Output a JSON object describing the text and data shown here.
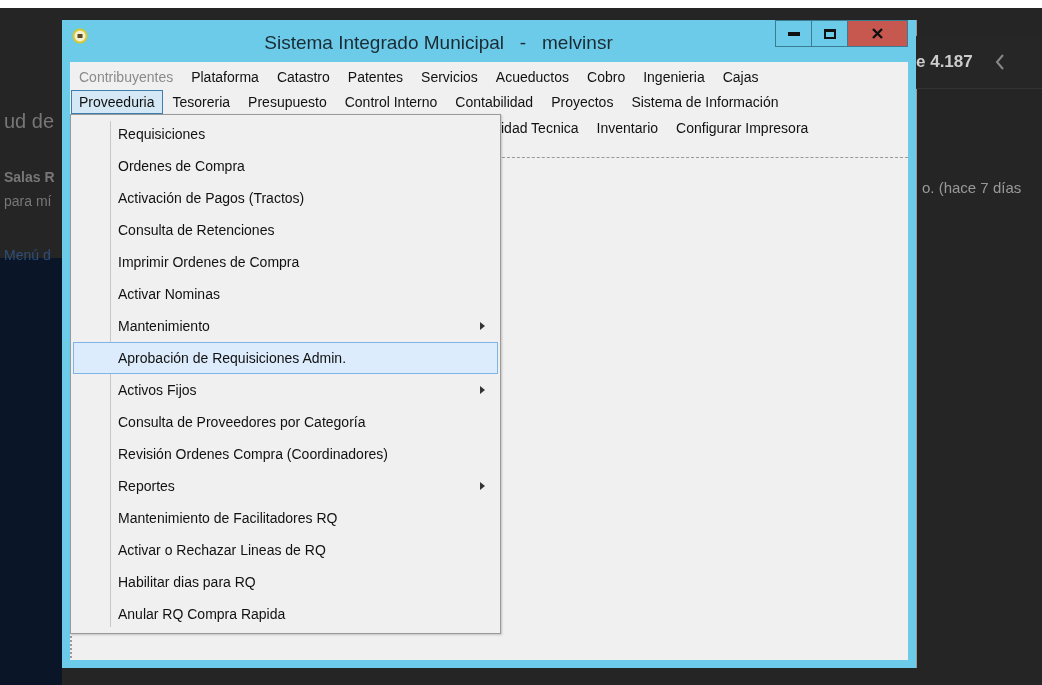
{
  "background_page": {
    "left_texts": [
      {
        "kind": "heading",
        "text": "ud de"
      },
      {
        "kind": "bold",
        "text": "Salas R"
      },
      {
        "kind": "plain",
        "text": "para mí"
      },
      {
        "kind": "link",
        "text": "Menú d"
      }
    ],
    "counter": "e 4.187",
    "note": "o. (hace 7 días"
  },
  "window": {
    "title": "Sistema Integrado Municipal   -   melvinsr"
  },
  "menu_rows": [
    [
      {
        "label": "Contribuyentes",
        "disabled": true,
        "selected": false
      },
      {
        "label": "Plataforma",
        "disabled": false,
        "selected": false
      },
      {
        "label": "Catastro",
        "disabled": false,
        "selected": false
      },
      {
        "label": "Patentes",
        "disabled": false,
        "selected": false
      },
      {
        "label": "Servicios",
        "disabled": false,
        "selected": false
      },
      {
        "label": "Acueductos",
        "disabled": false,
        "selected": false
      },
      {
        "label": "Cobro",
        "disabled": false,
        "selected": false
      },
      {
        "label": "Ingenieria",
        "disabled": false,
        "selected": false
      },
      {
        "label": "Cajas",
        "disabled": false,
        "selected": false
      }
    ],
    [
      {
        "label": "Proveeduria",
        "disabled": false,
        "selected": true
      },
      {
        "label": "Tesoreria",
        "disabled": false,
        "selected": false
      },
      {
        "label": "Presupuesto",
        "disabled": false,
        "selected": false
      },
      {
        "label": "Control Interno",
        "disabled": false,
        "selected": false
      },
      {
        "label": "Contabilidad",
        "disabled": false,
        "selected": false
      },
      {
        "label": "Proyectos",
        "disabled": false,
        "selected": false
      },
      {
        "label": "Sistema de Información",
        "disabled": false,
        "selected": false
      }
    ],
    [
      {
        "label": "idad Tecnica",
        "disabled": false,
        "selected": false
      },
      {
        "label": "Inventario",
        "disabled": false,
        "selected": false
      },
      {
        "label": "Configurar Impresora",
        "disabled": false,
        "selected": false
      }
    ]
  ],
  "dropdown": [
    {
      "label": "Requisiciones",
      "has_submenu": false,
      "selected": false
    },
    {
      "label": "Ordenes de Compra",
      "has_submenu": false,
      "selected": false
    },
    {
      "label": "Activación de Pagos (Tractos)",
      "has_submenu": false,
      "selected": false
    },
    {
      "label": "Consulta de Retenciones",
      "has_submenu": false,
      "selected": false
    },
    {
      "label": "Imprimir Ordenes de Compra",
      "has_submenu": false,
      "selected": false
    },
    {
      "label": "Activar Nominas",
      "has_submenu": false,
      "selected": false
    },
    {
      "label": "Mantenimiento",
      "has_submenu": true,
      "selected": false
    },
    {
      "label": "Aprobación de Requisiciones Admin.",
      "has_submenu": false,
      "selected": true
    },
    {
      "label": "Activos Fijos",
      "has_submenu": true,
      "selected": false
    },
    {
      "label": "Consulta de Proveedores por Categoría",
      "has_submenu": false,
      "selected": false
    },
    {
      "label": "Revisión Ordenes Compra (Coordinadores)",
      "has_submenu": false,
      "selected": false
    },
    {
      "label": "Reportes",
      "has_submenu": true,
      "selected": false
    },
    {
      "label": "Mantenimiento de Facilitadores RQ",
      "has_submenu": false,
      "selected": false
    },
    {
      "label": "Activar o Rechazar Lineas de RQ",
      "has_submenu": false,
      "selected": false
    },
    {
      "label": "Habilitar dias para RQ",
      "has_submenu": false,
      "selected": false
    },
    {
      "label": "Anular RQ Compra Rapida",
      "has_submenu": false,
      "selected": false
    }
  ]
}
